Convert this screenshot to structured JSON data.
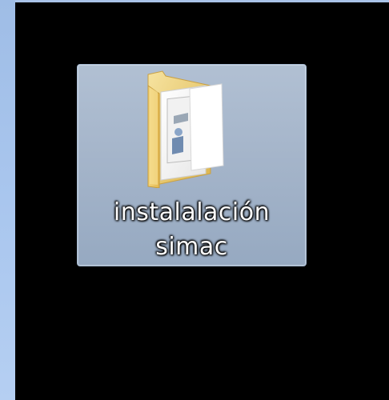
{
  "desktop": {
    "icon": {
      "type": "folder-icon",
      "label_line1": "instalalación",
      "label_line2": "simac",
      "selected": true
    }
  },
  "colors": {
    "desktop_background": "#000000",
    "left_strip": "#a9c6ee",
    "selection": "#a5b5ca",
    "folder_yellow": "#f2d27a"
  }
}
